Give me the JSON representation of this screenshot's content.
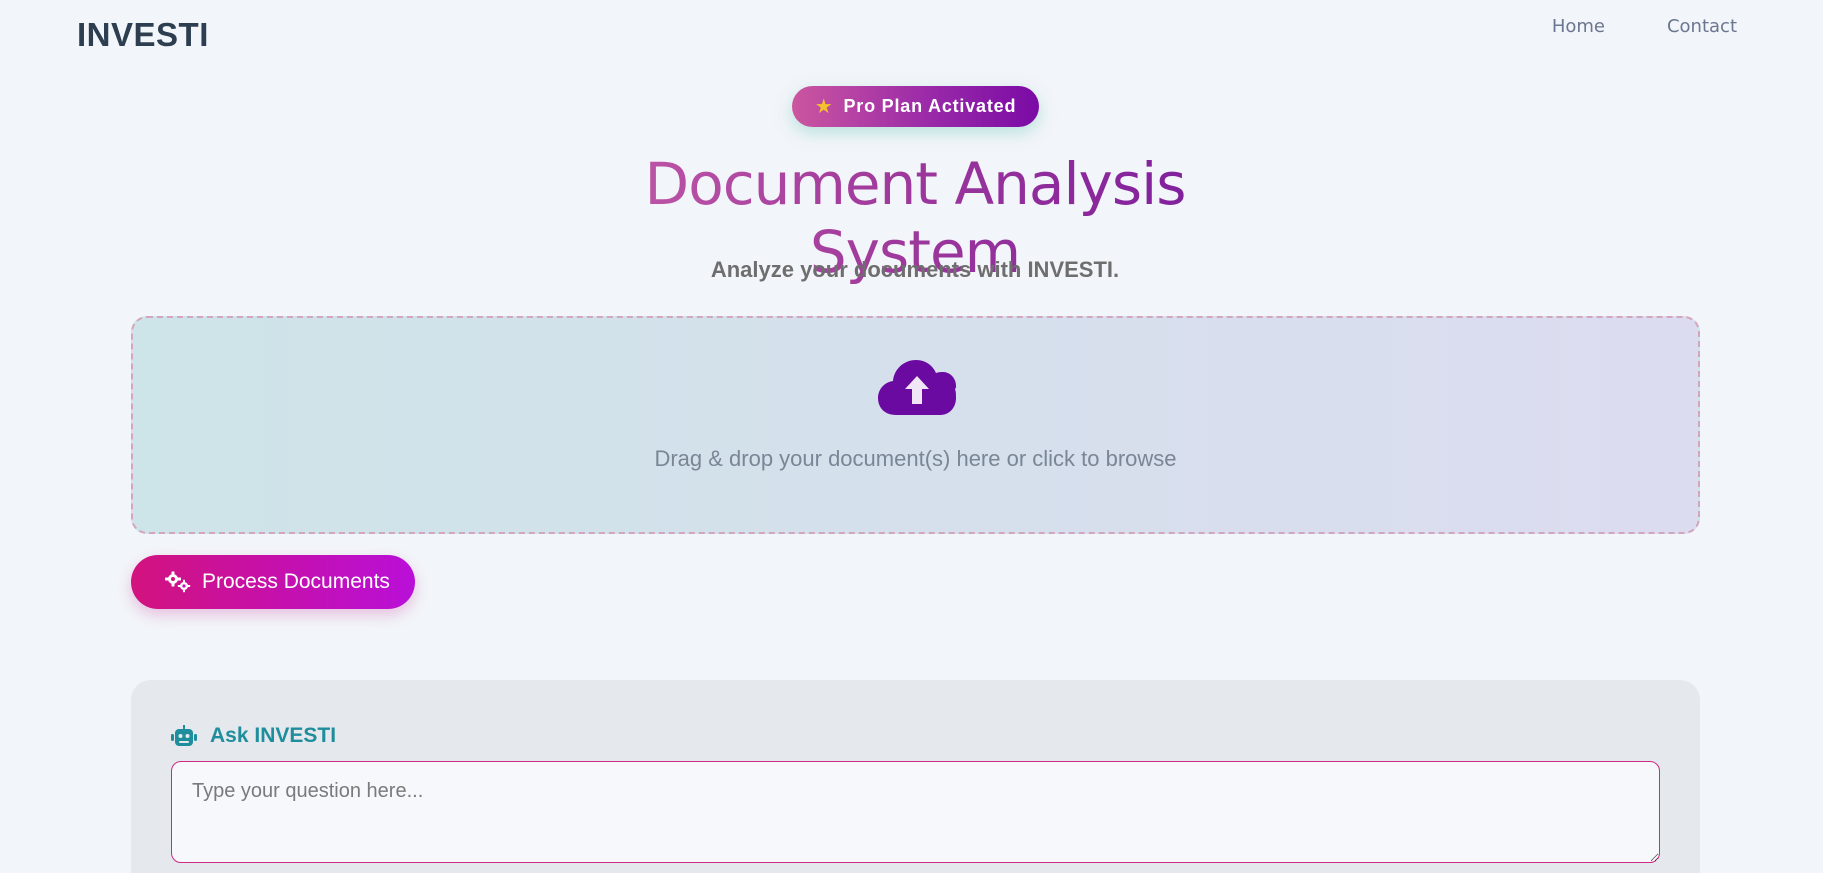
{
  "header": {
    "brand": "INVESTI",
    "nav": [
      {
        "label": "Home"
      },
      {
        "label": "Contact"
      }
    ]
  },
  "badge": {
    "icon": "star-icon",
    "label": "Pro Plan Activated"
  },
  "main": {
    "title": "Document Analysis System",
    "subtitle": "Analyze your documents with INVESTI."
  },
  "dropzone": {
    "icon": "cloud-upload-icon",
    "hint": "Drag & drop your document(s) here or click to browse"
  },
  "process": {
    "icon": "gears-icon",
    "label": "Process Documents"
  },
  "ask": {
    "icon": "robot-icon",
    "title": "Ask INVESTI",
    "placeholder": "Type your question here...",
    "value": ""
  },
  "colors": {
    "accent_pink": "#d2127d",
    "accent_purple": "#7a0ba5",
    "teal": "#1f8e9c",
    "text_dark": "#2c3e50"
  }
}
